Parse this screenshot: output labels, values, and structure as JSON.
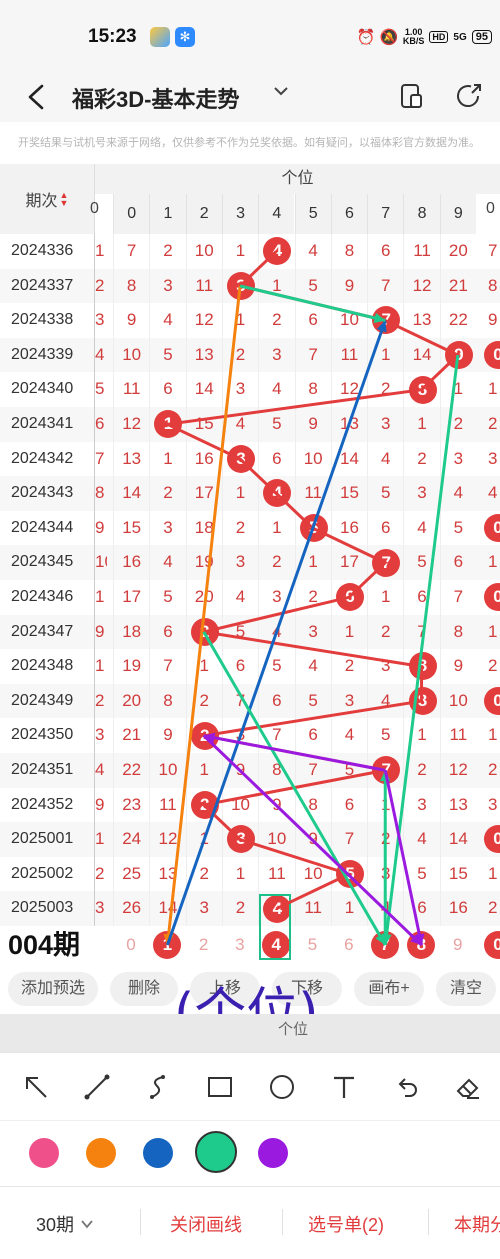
{
  "status_bar": {
    "time": "15:23",
    "net_speed_value": "1.00",
    "net_speed_unit": "KB/S",
    "hd_badge": "HD",
    "signal_label": "5G",
    "battery": "95"
  },
  "header": {
    "title": "福彩3D-基本走势",
    "back_label": "‹",
    "caret": "⌄"
  },
  "disclaimer": "开奖结果与试机号来源于网络，仅供参考不作为兑奖依据。如有疑问，以福体彩官方数据为准。",
  "table": {
    "period_header": "期次",
    "group_header": "个位",
    "left_edge_digit": "0",
    "right_edge_digit": "0",
    "digits": [
      "0",
      "1",
      "2",
      "3",
      "4",
      "5",
      "6",
      "7",
      "8",
      "9"
    ],
    "rows": [
      {
        "period": "2024336",
        "left": "1",
        "cells": [
          "7",
          "2",
          "10",
          "1",
          "4",
          "4",
          "8",
          "6",
          "11",
          "20"
        ],
        "hit": 4,
        "right": "7"
      },
      {
        "period": "2024337",
        "left": "2",
        "cells": [
          "8",
          "3",
          "11",
          "3",
          "1",
          "5",
          "9",
          "7",
          "12",
          "21"
        ],
        "hit": 3,
        "right": "8"
      },
      {
        "period": "2024338",
        "left": "3",
        "cells": [
          "9",
          "4",
          "12",
          "1",
          "2",
          "6",
          "10",
          "7",
          "13",
          "22"
        ],
        "hit": 7,
        "right": "9"
      },
      {
        "period": "2024339",
        "left": "4",
        "cells": [
          "10",
          "5",
          "13",
          "2",
          "3",
          "7",
          "11",
          "1",
          "14",
          "9"
        ],
        "hit": 9,
        "right": "0"
      },
      {
        "period": "2024340",
        "left": "5",
        "cells": [
          "11",
          "6",
          "14",
          "3",
          "4",
          "8",
          "12",
          "2",
          "8",
          "1"
        ],
        "hit": 8,
        "right": "1"
      },
      {
        "period": "2024341",
        "left": "6",
        "cells": [
          "12",
          "1",
          "15",
          "4",
          "5",
          "9",
          "13",
          "3",
          "1",
          "2"
        ],
        "hit": 1,
        "right": "2"
      },
      {
        "period": "2024342",
        "left": "7",
        "cells": [
          "13",
          "1",
          "16",
          "3",
          "6",
          "10",
          "14",
          "4",
          "2",
          "3"
        ],
        "hit": 3,
        "right": "3"
      },
      {
        "period": "2024343",
        "left": "8",
        "cells": [
          "14",
          "2",
          "17",
          "1",
          "4",
          "11",
          "15",
          "5",
          "3",
          "4"
        ],
        "hit": 4,
        "right": "4"
      },
      {
        "period": "2024344",
        "left": "9",
        "cells": [
          "15",
          "3",
          "18",
          "2",
          "1",
          "5",
          "16",
          "6",
          "4",
          "5"
        ],
        "hit": 5,
        "right": "0"
      },
      {
        "period": "2024345",
        "left": "10",
        "cells": [
          "16",
          "4",
          "19",
          "3",
          "2",
          "1",
          "17",
          "7",
          "5",
          "6"
        ],
        "hit": 7,
        "right": "1"
      },
      {
        "period": "2024346",
        "left": "1",
        "cells": [
          "17",
          "5",
          "20",
          "4",
          "3",
          "2",
          "6",
          "1",
          "6",
          "7"
        ],
        "hit": 6,
        "right": "0"
      },
      {
        "period": "2024347",
        "left": "9",
        "cells": [
          "18",
          "6",
          "2",
          "5",
          "4",
          "3",
          "1",
          "2",
          "7",
          "8"
        ],
        "hit": 2,
        "right": "1"
      },
      {
        "period": "2024348",
        "left": "1",
        "cells": [
          "19",
          "7",
          "1",
          "6",
          "5",
          "4",
          "2",
          "3",
          "8",
          "9"
        ],
        "hit": 8,
        "right": "2"
      },
      {
        "period": "2024349",
        "left": "2",
        "cells": [
          "20",
          "8",
          "2",
          "7",
          "6",
          "5",
          "3",
          "4",
          "8",
          "10"
        ],
        "hit": 8,
        "right": "0"
      },
      {
        "period": "2024350",
        "left": "3",
        "cells": [
          "21",
          "9",
          "2",
          "3",
          "7",
          "6",
          "4",
          "5",
          "1",
          "11"
        ],
        "hit": 2,
        "right": "1"
      },
      {
        "period": "2024351",
        "left": "4",
        "cells": [
          "22",
          "10",
          "1",
          "9",
          "8",
          "7",
          "5",
          "7",
          "2",
          "12"
        ],
        "hit": 7,
        "right": "2"
      },
      {
        "period": "2024352",
        "left": "9",
        "cells": [
          "23",
          "11",
          "2",
          "10",
          "9",
          "8",
          "6",
          "1",
          "3",
          "13"
        ],
        "hit": 2,
        "right": "3"
      },
      {
        "period": "2025001",
        "left": "1",
        "cells": [
          "24",
          "12",
          "1",
          "3",
          "10",
          "9",
          "7",
          "2",
          "4",
          "14"
        ],
        "hit": 3,
        "right": "0"
      },
      {
        "period": "2025002",
        "left": "2",
        "cells": [
          "25",
          "13",
          "2",
          "1",
          "11",
          "10",
          "5",
          "3",
          "5",
          "15"
        ],
        "hit": 6,
        "right": "1"
      },
      {
        "period": "2025003",
        "left": "3",
        "cells": [
          "26",
          "14",
          "3",
          "2",
          "4",
          "11",
          "1",
          "4",
          "6",
          "16"
        ],
        "hit": 4,
        "right": "2"
      }
    ],
    "prediction": {
      "label": "004期",
      "cells": [
        "0",
        "1",
        "2",
        "3",
        "4",
        "5",
        "6",
        "7",
        "8",
        "9"
      ],
      "marked": [
        1,
        4,
        7,
        8
      ],
      "right": "0"
    }
  },
  "toolbar": {
    "add_label": "添加预选",
    "delete_label": "删除",
    "up_label": "上移",
    "down_label": "下移",
    "canvas_label": "画布+",
    "clear_label": "清空"
  },
  "annotation_text": "(个位)",
  "lower_strip_label": "个位",
  "draw_tools": [
    "arrow-tool",
    "line-tool",
    "curve-tool",
    "rectangle-tool",
    "circle-tool",
    "text-tool",
    "undo-tool",
    "eraser-tool"
  ],
  "colors": {
    "swatches": [
      "#f0508a",
      "#f5820f",
      "#1565c0",
      "#1ecb8c",
      "#9b1ae0"
    ],
    "selected_index": 3,
    "accent": "#e23c3c"
  },
  "bottom_bar": {
    "period_select": "30期",
    "close_draw": "关闭画线",
    "pick_list": "选号单(2)",
    "this_period": "本期分"
  }
}
